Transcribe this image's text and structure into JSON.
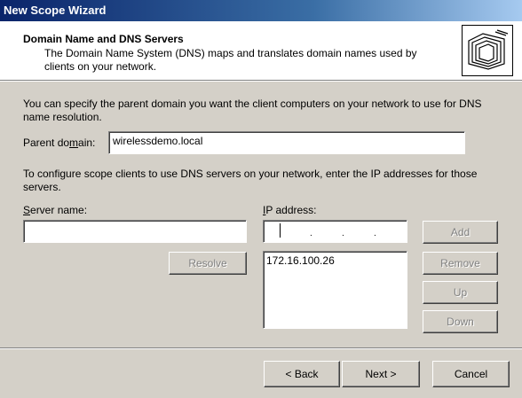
{
  "window": {
    "title": "New Scope Wizard"
  },
  "header": {
    "title": "Domain Name and DNS Servers",
    "description": "The Domain Name System (DNS) maps and translates domain names used by clients on your network.",
    "icon": "folder-stack-icon"
  },
  "body": {
    "parent_intro": "You can specify the parent domain you want the client computers on your network to use for DNS name resolution.",
    "parent_domain_label": "Parent domain:",
    "parent_domain_value": "wirelessdemo.local",
    "dns_intro": "To configure scope clients to use DNS servers on your network, enter the IP addresses for those servers.",
    "server_name_label": "Server name:",
    "server_name_value": "",
    "ip_address_label": "IP address:",
    "ip_list": [
      "172.16.100.26"
    ]
  },
  "buttons": {
    "resolve": "Resolve",
    "add": "Add",
    "remove": "Remove",
    "up": "Up",
    "down": "Down",
    "back": "< Back",
    "next": "Next >",
    "cancel": "Cancel"
  }
}
